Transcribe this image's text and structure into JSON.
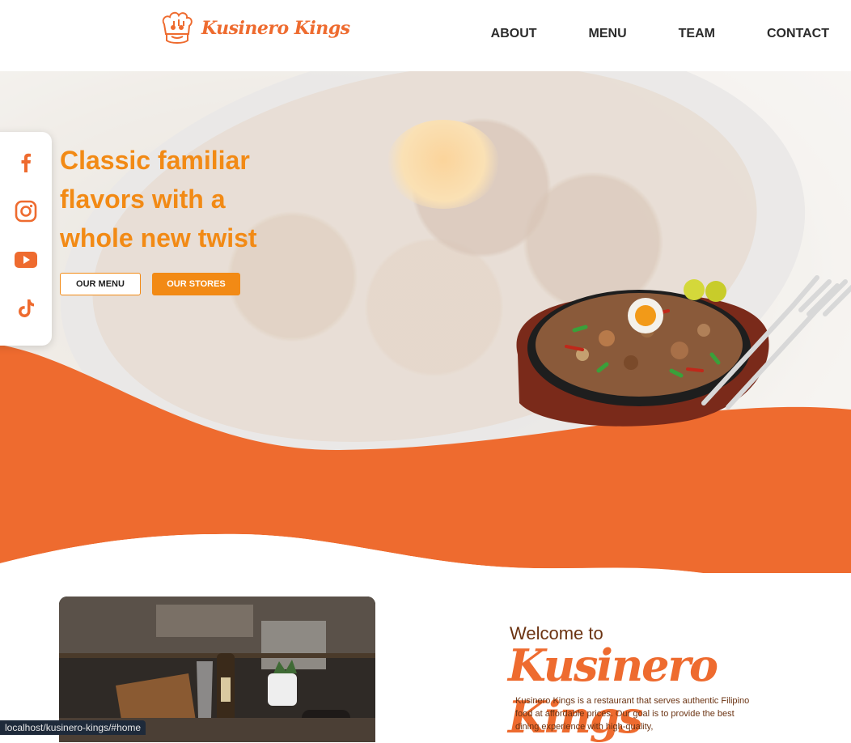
{
  "brand": {
    "name": "Kusinero Kings"
  },
  "nav": {
    "items": [
      "ABOUT",
      "MENU",
      "TEAM",
      "CONTACT"
    ]
  },
  "hero": {
    "headline": "Classic familiar flavors with a whole new twist",
    "buttons": {
      "menu": "OUR MENU",
      "stores": "OUR STORES"
    }
  },
  "social": {
    "icons": [
      "facebook-icon",
      "instagram-icon",
      "youtube-icon",
      "tiktok-icon"
    ]
  },
  "welcome": {
    "pre": "Welcome to",
    "title": "Kusinero Kings",
    "description": "Kusinero Kings is a restaurant that serves authentic Filipino food at affordable prices. Our goal is to provide the best dining experience with high-quality,"
  },
  "status_bar": {
    "url": "localhost/kusinero-kings/#home"
  },
  "colors": {
    "accent_orange": "#ee6b2f",
    "headline_orange": "#f28a15",
    "brown_text": "#6b3312"
  }
}
